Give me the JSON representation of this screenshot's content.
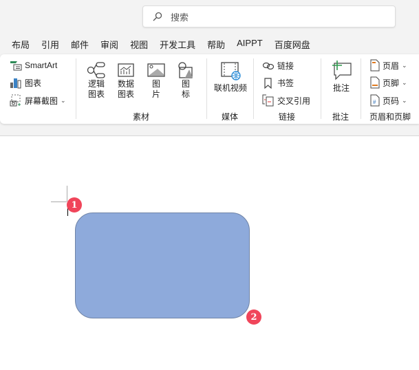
{
  "search": {
    "placeholder": "搜索"
  },
  "tabs": [
    "布局",
    "引用",
    "邮件",
    "审阅",
    "视图",
    "开发工具",
    "帮助",
    "AIPPT",
    "百度网盘"
  ],
  "ribbon": {
    "illustrations": {
      "smartart": "SmartArt",
      "chart": "图表",
      "screenshot": "屏幕截图"
    },
    "materials": {
      "label": "素材",
      "items": [
        [
          "逻辑",
          "图表"
        ],
        [
          "数据",
          "图表"
        ],
        [
          "图",
          "片"
        ],
        [
          "图",
          "标"
        ]
      ]
    },
    "media": {
      "label": "媒体",
      "online_video": "联机视频"
    },
    "links": {
      "label": "链接",
      "link": "链接",
      "bookmark": "书签",
      "cross_ref": "交叉引用"
    },
    "comments": {
      "label": "批注",
      "comment": "批注"
    },
    "header_footer": {
      "label": "页眉和页脚",
      "header": "页眉",
      "footer": "页脚",
      "page_number": "页码"
    }
  },
  "annotations": {
    "badge1": "1",
    "badge2": "2"
  },
  "colors": {
    "shape_fill": "#8eaadb",
    "badge": "#f0455a"
  }
}
